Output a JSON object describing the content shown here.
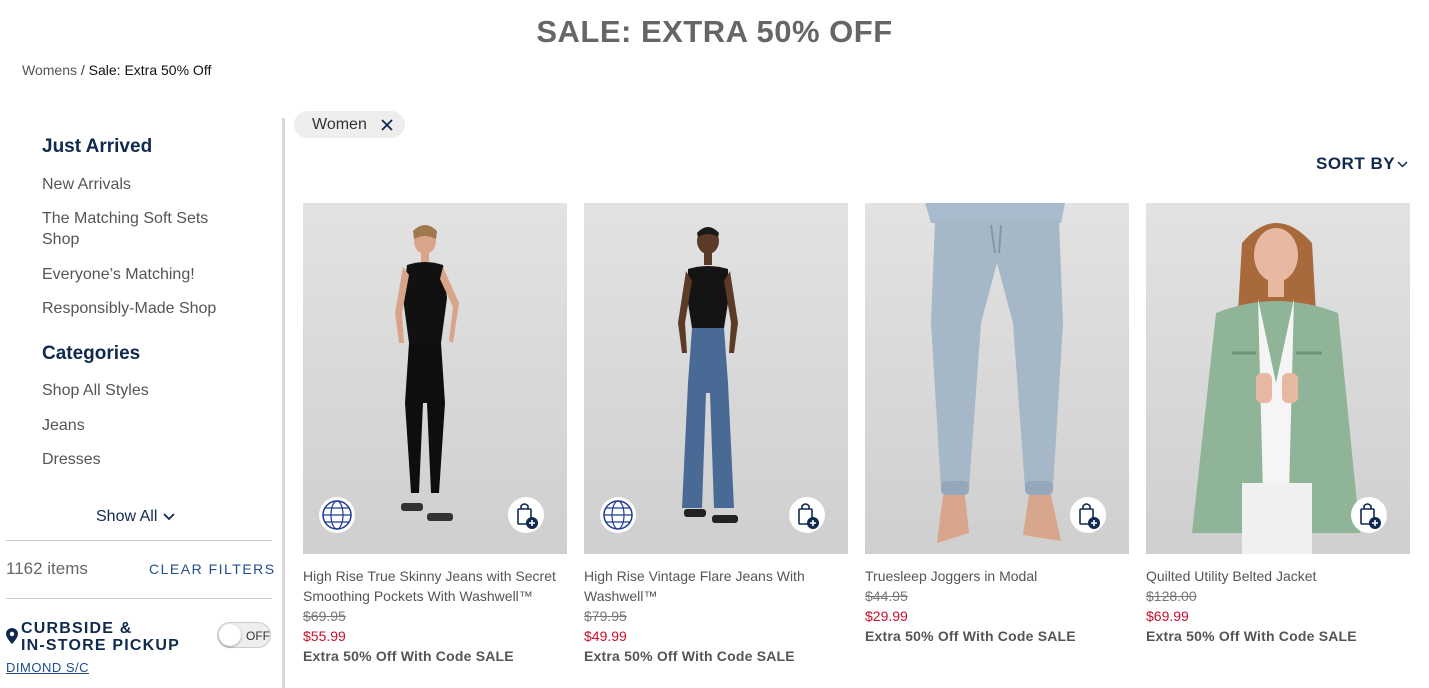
{
  "page": {
    "title": "SALE: EXTRA 50% OFF"
  },
  "breadcrumb": {
    "parent": "Womens",
    "separator": " / ",
    "current": "Sale: Extra 50% Off"
  },
  "sidebar": {
    "just_arrived": {
      "heading": "Just Arrived",
      "links": [
        "New Arrivals",
        "The Matching Soft Sets Shop",
        "Everyone’s Matching!",
        "Responsibly-Made Shop"
      ]
    },
    "categories": {
      "heading": "Categories",
      "links": [
        "Shop All Styles",
        "Jeans",
        "Dresses"
      ]
    },
    "show_all": "Show All",
    "item_count": "1162 items",
    "clear_filters": "CLEAR FILTERS",
    "pickup": {
      "label_line1": "CURBSIDE &",
      "label_line2": "IN-STORE PICKUP",
      "toggle_state": "OFF",
      "store": "DIMOND S/C"
    }
  },
  "filters": {
    "chip_label": "Women"
  },
  "sort": {
    "label": "SORT BY"
  },
  "colors": {
    "navy": "#0f2a4e",
    "sale_red": "#c8102e",
    "link_blue": "#1f4e8c"
  },
  "products": [
    {
      "name": "High Rise True Skinny Jeans with Secret Smoothing Pockets With Washwell™",
      "original_price": "$69.95",
      "sale_price": "$55.99",
      "promo": "Extra 50% Off With Code SALE",
      "icons": [
        "globe-icon",
        "bag-plus-icon"
      ]
    },
    {
      "name": "High Rise Vintage Flare Jeans With Washwell™",
      "original_price": "$79.95",
      "sale_price": "$49.99",
      "promo": "Extra 50% Off With Code SALE",
      "icons": [
        "globe-icon",
        "bag-plus-icon"
      ]
    },
    {
      "name": "Truesleep Joggers in Modal",
      "original_price": "$44.95",
      "sale_price": "$29.99",
      "promo": "Extra 50% Off With Code SALE",
      "icons": [
        "bag-plus-icon"
      ]
    },
    {
      "name": "Quilted Utility Belted Jacket",
      "original_price": "$128.00",
      "sale_price": "$69.99",
      "promo": "Extra 50% Off With Code SALE",
      "icons": [
        "bag-plus-icon"
      ]
    }
  ]
}
